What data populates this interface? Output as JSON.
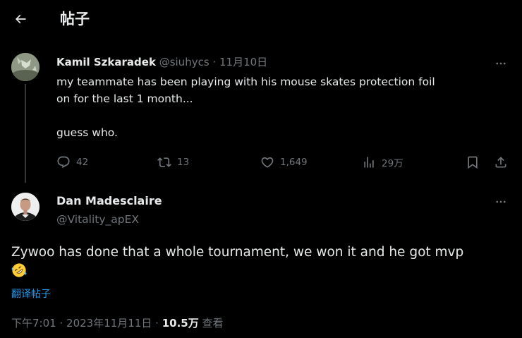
{
  "header": {
    "title": "帖子",
    "back_icon": "arrow-left-icon"
  },
  "parent_tweet": {
    "author_name": "Kamil Szkaradek",
    "author_handle": "@siuhycs",
    "separator": "·",
    "date": "11月10日",
    "text_lines": [
      "my teammate has been playing with his mouse skates protection foil",
      "on for the last 1 month...",
      "guess who."
    ],
    "actions": {
      "replies": "42",
      "retweets": "13",
      "likes": "1,649",
      "views": "29万"
    }
  },
  "reply": {
    "author_name": "Dan Madesclaire",
    "author_handle": "@Vitality_apEX",
    "text": "Zywoo has done that a whole tournament, we won it and he got mvp",
    "emoji": "rolling-on-floor-laughing",
    "translate_label": "翻译帖子",
    "meta": {
      "time": "下午7:01",
      "separator": "·",
      "date": "2023年11月11日",
      "views_count": "10.5万",
      "views_label": "查看"
    }
  },
  "colors": {
    "background": "#000000",
    "text": "#e7e9ea",
    "muted": "#71767b",
    "accent": "#1d9bf0",
    "thread_line": "#333639"
  }
}
